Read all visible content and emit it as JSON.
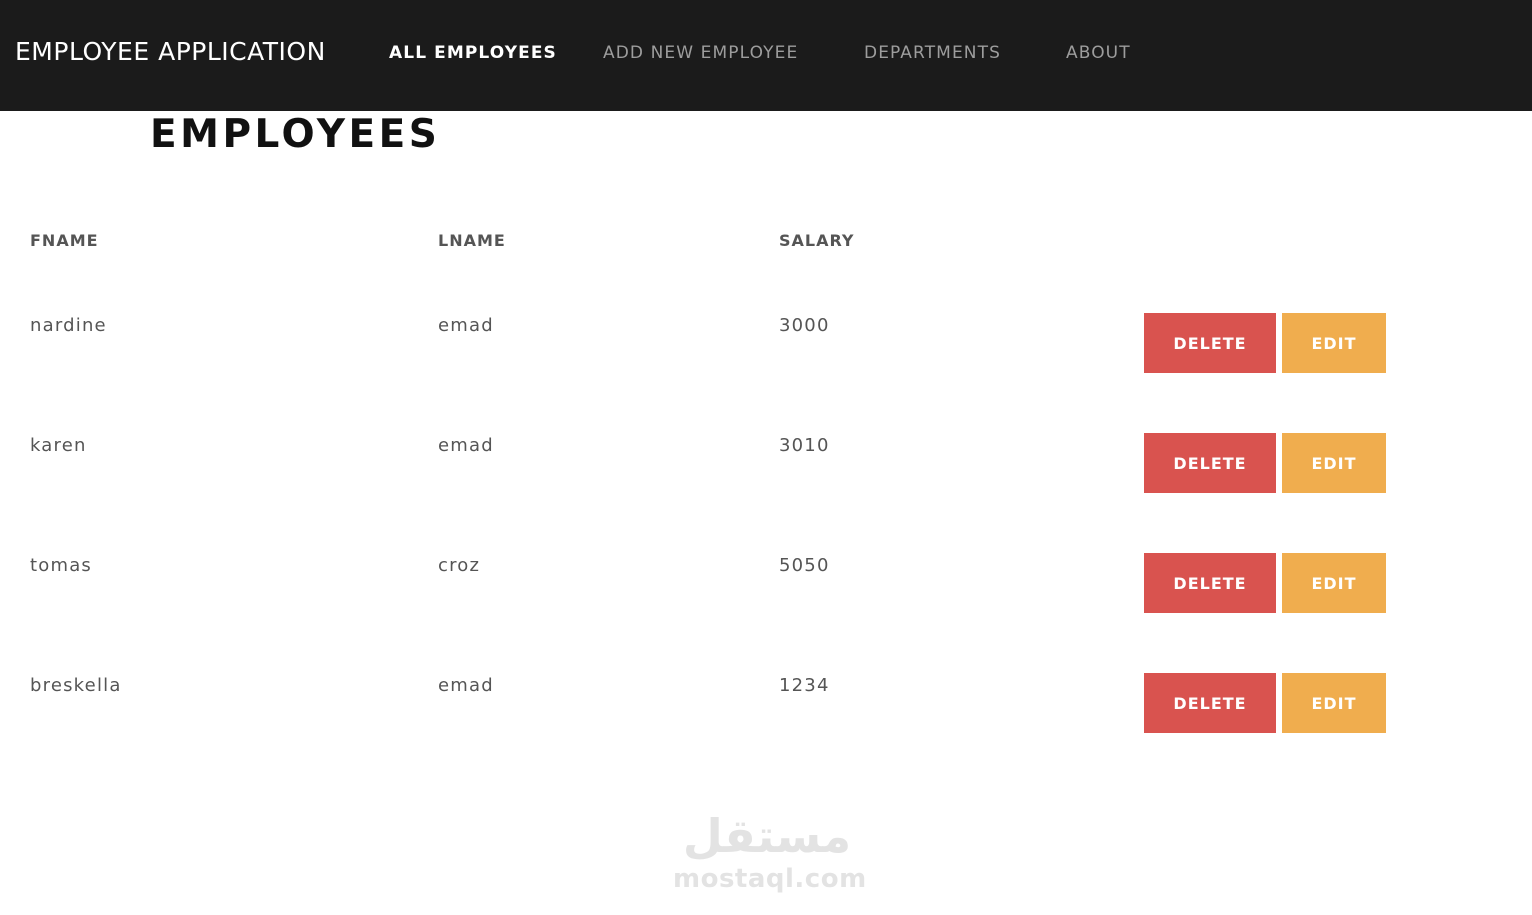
{
  "navbar": {
    "brand": "EMPLOYEE APPLICATION",
    "links": [
      {
        "label": "ALL EMPLOYEES",
        "active": true
      },
      {
        "label": "ADD NEW EMPLOYEE",
        "active": false
      },
      {
        "label": "DEPARTMENTS",
        "active": false
      },
      {
        "label": "ABOUT",
        "active": false
      }
    ]
  },
  "page": {
    "title": "EMPLOYEES"
  },
  "table": {
    "columns": [
      "FNAME",
      "LNAME",
      "SALARY"
    ],
    "rows": [
      {
        "fname": "nardine",
        "lname": "emad",
        "salary": "3000"
      },
      {
        "fname": "karen",
        "lname": "emad",
        "salary": "3010"
      },
      {
        "fname": "tomas",
        "lname": "croz",
        "salary": "5050"
      },
      {
        "fname": "breskella",
        "lname": "emad",
        "salary": "1234"
      }
    ],
    "actions": {
      "delete_label": "DELETE",
      "edit_label": "EDIT"
    }
  },
  "watermark": {
    "arabic": "مستقل",
    "latin": "mostaql.com"
  },
  "colors": {
    "navbar_bg": "#1b1b1b",
    "delete": "#d9534f",
    "edit": "#f0ad4e"
  }
}
